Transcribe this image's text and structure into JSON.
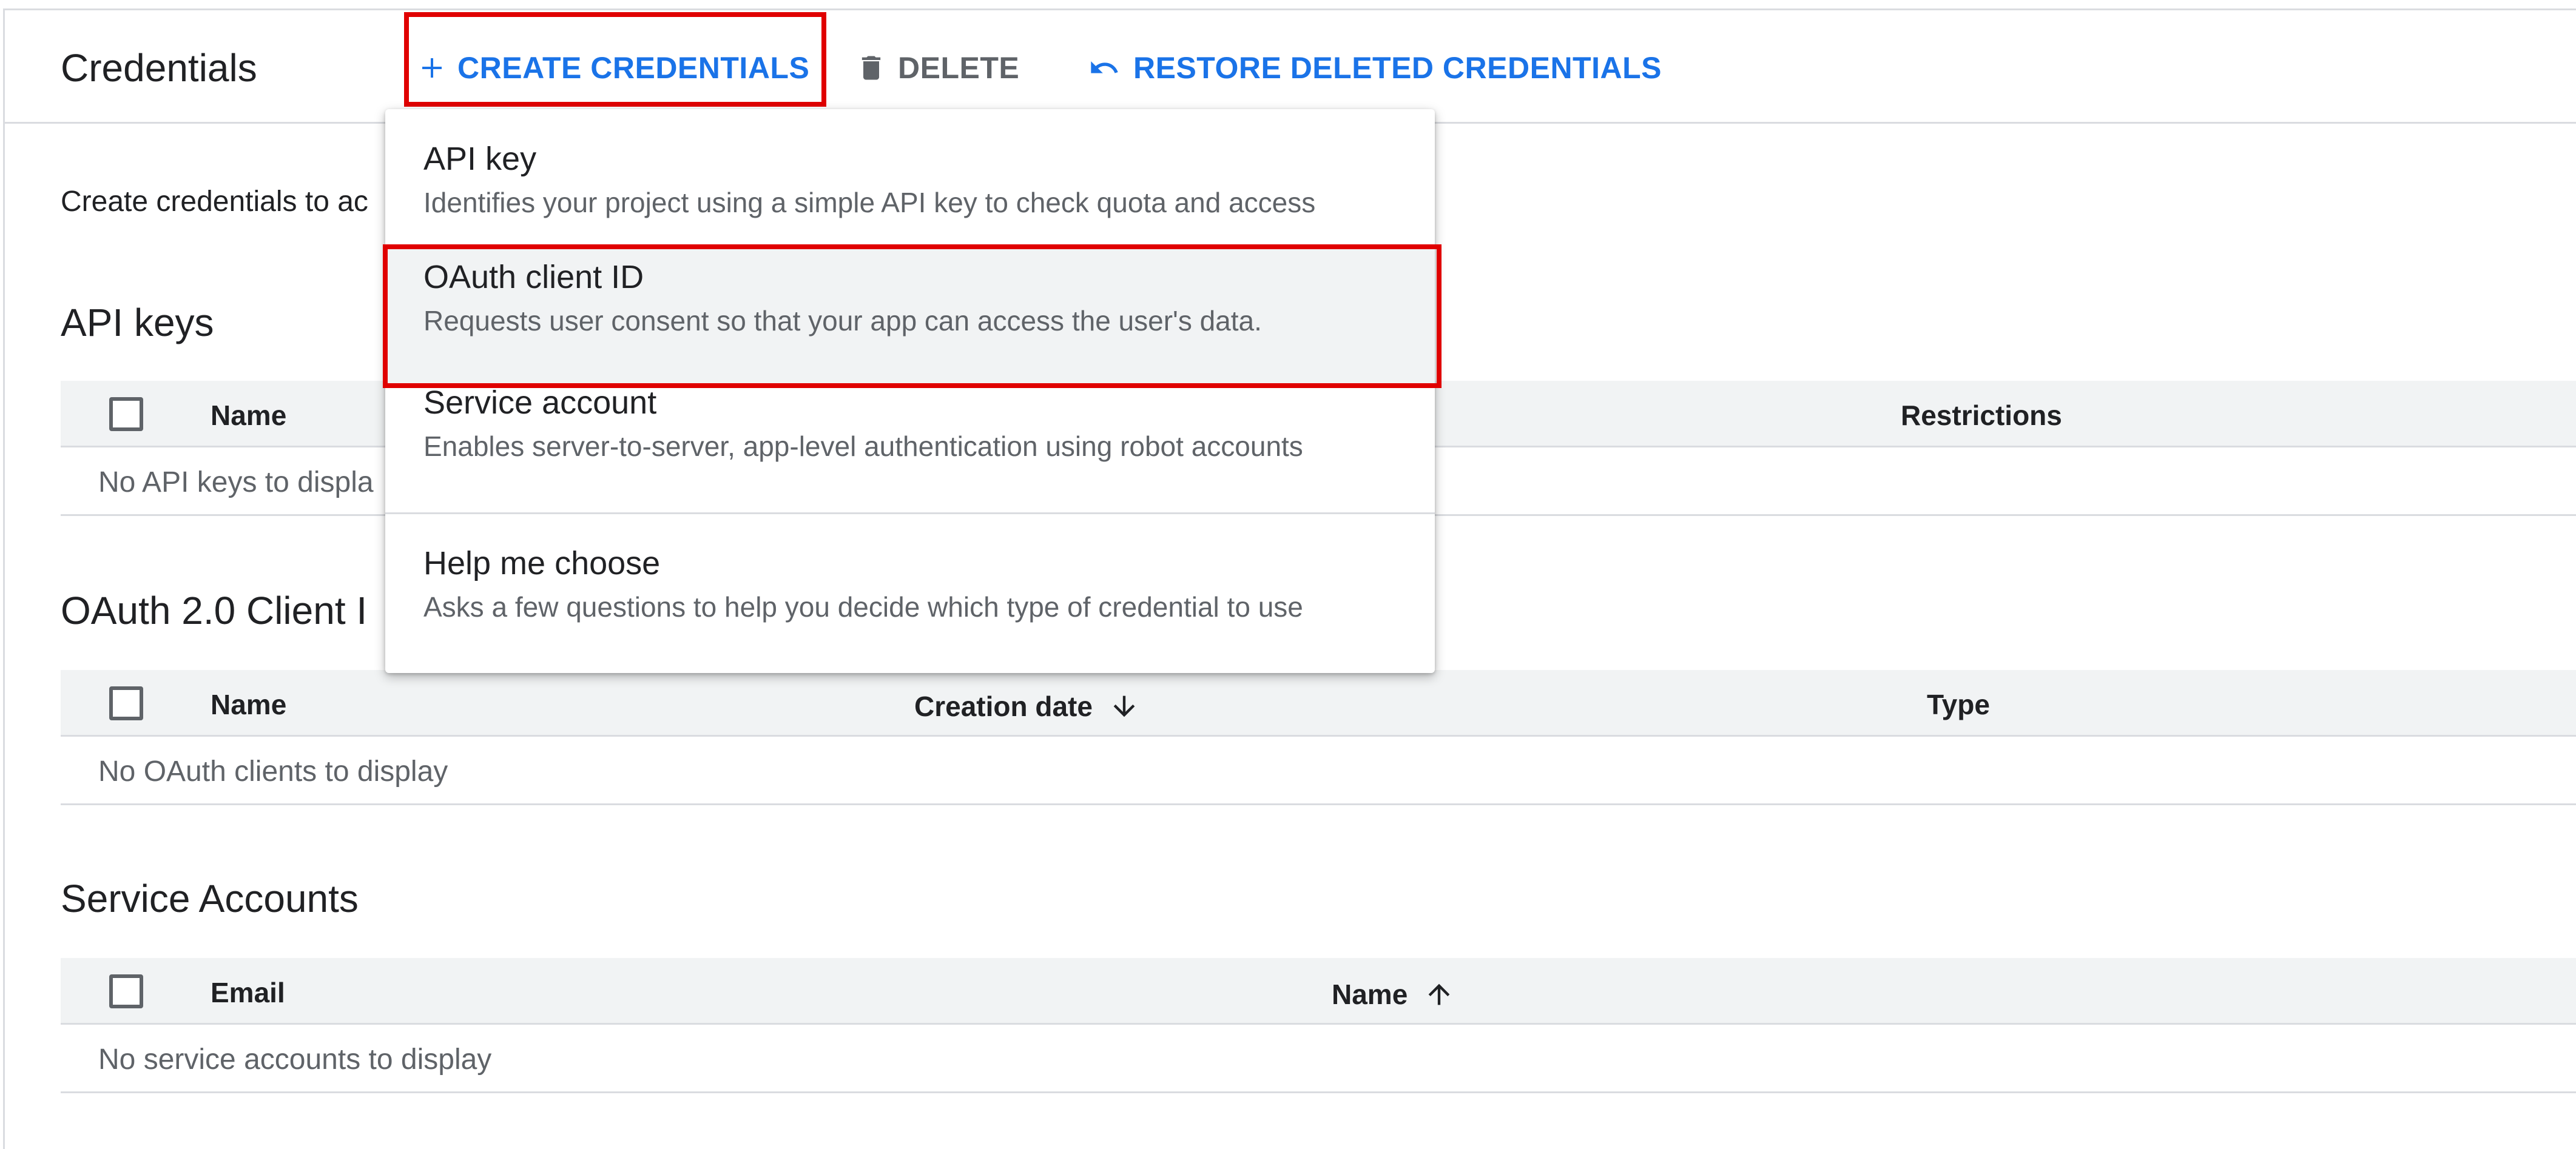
{
  "header": {
    "title": "Credentials",
    "toolbar": {
      "create_label": "CREATE CREDENTIALS",
      "delete_label": "DELETE",
      "restore_label": "RESTORE DELETED CREDENTIALS"
    }
  },
  "intro_text": "Create credentials to ac",
  "menu": {
    "items": [
      {
        "title": "API key",
        "description": "Identifies your project using a simple API key to check quota and access"
      },
      {
        "title": "OAuth client ID",
        "description": "Requests user consent so that your app can access the user's data."
      },
      {
        "title": "Service account",
        "description": "Enables server-to-server, app-level authentication using robot accounts"
      },
      {
        "title": "Help me choose",
        "description": "Asks a few questions to help you decide which type of credential to use"
      }
    ],
    "selected_index": 1
  },
  "sections": {
    "api_keys": {
      "title": "API keys",
      "columns": [
        "Name",
        "Restrictions"
      ],
      "empty_text": "No API keys to displa"
    },
    "oauth": {
      "title": "OAuth 2.0 Client I",
      "columns": [
        "Name",
        "Creation date",
        "Type"
      ],
      "empty_text": "No OAuth clients to display"
    },
    "service_accounts": {
      "title": "Service Accounts",
      "columns": [
        "Email",
        "Name"
      ],
      "empty_text": "No service accounts to display"
    }
  },
  "colors": {
    "accent": "#1a73e8",
    "highlight_box": "#e00000",
    "muted": "#5f6368",
    "header_bg": "#f1f3f4"
  }
}
